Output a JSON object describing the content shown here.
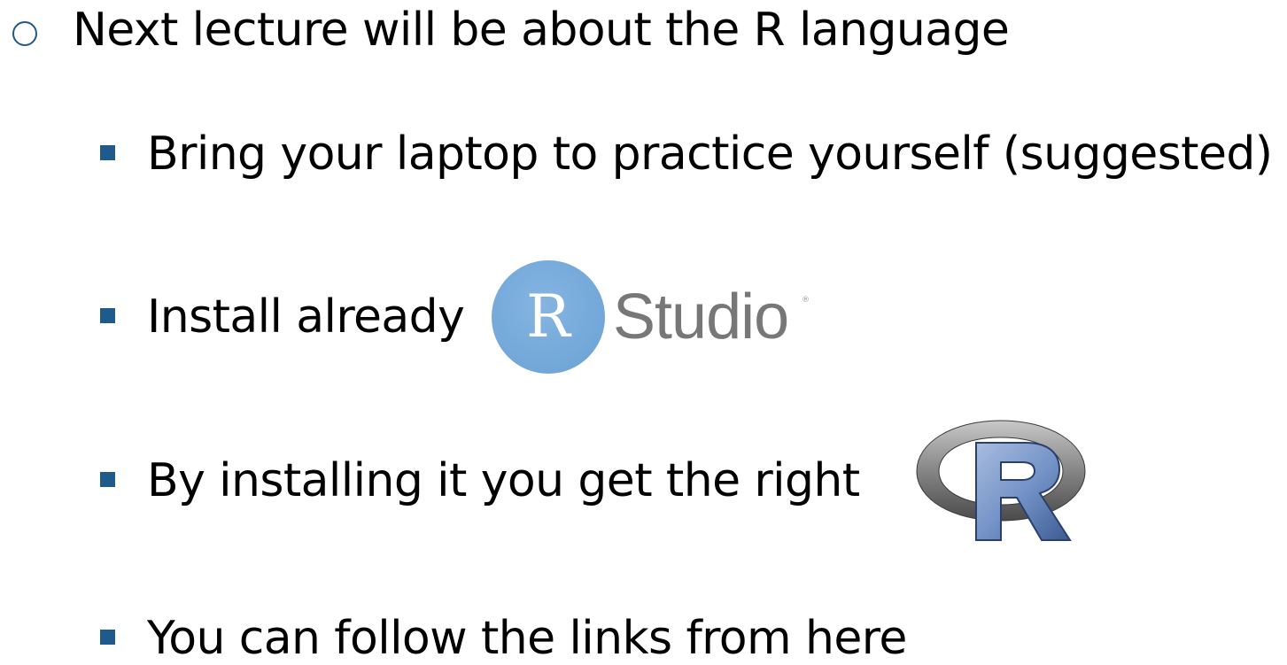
{
  "bullets": {
    "level1": {
      "text": "Next lecture will be about the R language"
    },
    "items": [
      {
        "text": "Bring your laptop to practice yourself (suggested)"
      },
      {
        "text": "Install already"
      },
      {
        "text": "By installing it you get the right"
      },
      {
        "text": "You can follow the links from here"
      }
    ]
  },
  "logos": {
    "rstudio": {
      "badge_letter": "R",
      "word": "Studio",
      "registered": "®",
      "badge_color": "#75aadb",
      "word_color": "#777777"
    },
    "r": {
      "letter": "R",
      "ring_color": "#8a8a8a",
      "letter_color": "#5a7fb8"
    }
  },
  "colors": {
    "bullet": "#1f5a8c",
    "text": "#000000"
  }
}
